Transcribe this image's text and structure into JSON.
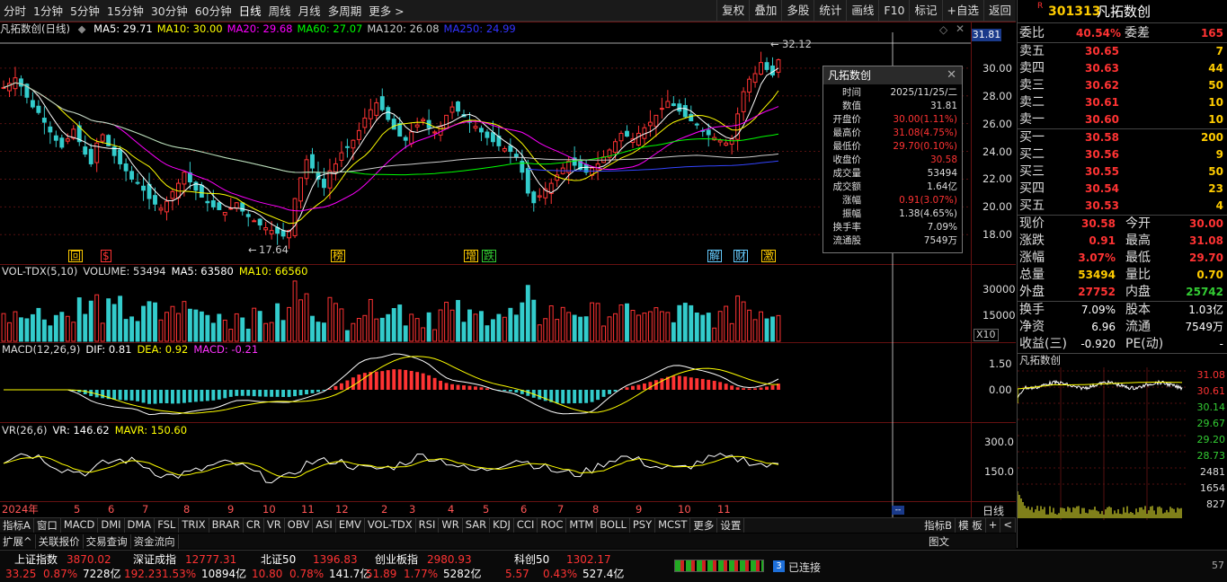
{
  "toolbar": {
    "periods": [
      "分时",
      "1分钟",
      "5分钟",
      "15分钟",
      "30分钟",
      "60分钟",
      "日线",
      "周线",
      "月线",
      "多周期",
      "更多 >"
    ],
    "active_period": "日线",
    "actions": [
      "复权",
      "叠加",
      "多股",
      "统计",
      "画线",
      "F10",
      "标记",
      "+自选",
      "返回"
    ]
  },
  "chart_header": {
    "name": "凡拓数创(日线)",
    "ma": [
      {
        "label": "MA5: 29.71",
        "color": "#ffffff"
      },
      {
        "label": "MA10: 30.00",
        "color": "#ffff00"
      },
      {
        "label": "MA20: 29.68",
        "color": "#ff00ff"
      },
      {
        "label": "MA60: 27.07",
        "color": "#00ff00"
      },
      {
        "label": "MA120: 26.08",
        "color": "#cccccc"
      },
      {
        "label": "MA250: 24.99",
        "color": "#3333ff"
      }
    ],
    "high_mark": "32.12",
    "low_mark": "17.64",
    "current_price_tag": "31.81",
    "price_axis": [
      "30.00",
      "28.00",
      "26.00",
      "24.00",
      "22.00",
      "20.00",
      "18.00"
    ],
    "event_markers": [
      {
        "text": "回",
        "color": "#ffcc00"
      },
      {
        "text": "$",
        "color": "#ff3333"
      },
      {
        "text": "榜",
        "color": "#ffcc00"
      },
      {
        "text": "增",
        "color": "#ffcc00"
      },
      {
        "text": "跌",
        "color": "#33cc33"
      },
      {
        "text": "解",
        "color": "#66ccff"
      },
      {
        "text": "财",
        "color": "#66ccff"
      },
      {
        "text": "激",
        "color": "#ffcc00"
      }
    ]
  },
  "popup": {
    "title": "凡拓数创",
    "rows": [
      {
        "k": "时间",
        "v": "2025/11/25/二",
        "c": "#dddddd"
      },
      {
        "k": "数值",
        "v": "31.81",
        "c": "#dddddd"
      },
      {
        "k": "开盘价",
        "v": "30.00(1.11%)",
        "c": "#ff3333"
      },
      {
        "k": "最高价",
        "v": "31.08(4.75%)",
        "c": "#ff3333"
      },
      {
        "k": "最低价",
        "v": "29.70(0.10%)",
        "c": "#ff3333"
      },
      {
        "k": "收盘价",
        "v": "30.58",
        "c": "#ff3333"
      },
      {
        "k": "成交量",
        "v": "53494",
        "c": "#dddddd"
      },
      {
        "k": "成交额",
        "v": "1.64亿",
        "c": "#dddddd"
      },
      {
        "k": "涨幅",
        "v": "0.91(3.07%)",
        "c": "#ff3333"
      },
      {
        "k": "振幅",
        "v": "1.38(4.65%)",
        "c": "#dddddd"
      },
      {
        "k": "换手率",
        "v": "7.09%",
        "c": "#dddddd"
      },
      {
        "k": "流通股",
        "v": "7549万",
        "c": "#dddddd"
      }
    ]
  },
  "vol_panel": {
    "header": [
      "VOL-TDX(5,10)",
      "VOLUME: 53494",
      "MA5: 63580",
      "MA10: 66560"
    ],
    "axis": [
      "30000",
      "15000"
    ],
    "unit": "X10"
  },
  "macd_panel": {
    "header": [
      "MACD(12,26,9)",
      "DIF: 0.81",
      "DEA: 0.92",
      "MACD: -0.21"
    ],
    "axis": [
      "1.50",
      "0.00"
    ]
  },
  "vr_panel": {
    "header": [
      "VR(26,6)",
      "VR: 146.62",
      "MAVR: 150.60"
    ],
    "axis": [
      "300.0",
      "150.0"
    ]
  },
  "time_axis": [
    "2024年",
    "5",
    "6",
    "7",
    "8",
    "9",
    "10",
    "11",
    "12",
    "2",
    "3",
    "4",
    "5",
    "6",
    "7",
    "8",
    "9",
    "10",
    "11"
  ],
  "bottom_period_label": "日线",
  "indicator_tabs": [
    "指标A",
    "窗口",
    "MACD",
    "DMI",
    "DMA",
    "FSL",
    "TRIX",
    "BRAR",
    "CR",
    "VR",
    "OBV",
    "ASI",
    "EMV",
    "VOL-TDX",
    "RSI",
    "WR",
    "SAR",
    "KDJ",
    "CCI",
    "ROC",
    "MTM",
    "BOLL",
    "PSY",
    "MCST",
    "更多",
    "设置"
  ],
  "indicator_tabs_right": [
    "指标B",
    "模 板",
    "+",
    "<"
  ],
  "sub_tabs": [
    "扩展^",
    "关联报价",
    "交易查询",
    "资金流向"
  ],
  "sub_tabs_right": "图文",
  "right_panel": {
    "code": "301313",
    "name": "凡拓数创",
    "badge": "R",
    "weibi": {
      "label": "委比",
      "value": "40.54%",
      "label2": "委差",
      "value2": "165"
    },
    "sells": [
      {
        "label": "卖五",
        "price": "30.65",
        "vol": "7"
      },
      {
        "label": "卖四",
        "price": "30.63",
        "vol": "44"
      },
      {
        "label": "卖三",
        "price": "30.62",
        "vol": "50"
      },
      {
        "label": "卖二",
        "price": "30.61",
        "vol": "10"
      },
      {
        "label": "卖一",
        "price": "30.60",
        "vol": "10"
      }
    ],
    "buys": [
      {
        "label": "买一",
        "price": "30.58",
        "vol": "200"
      },
      {
        "label": "买二",
        "price": "30.56",
        "vol": "9"
      },
      {
        "label": "买三",
        "price": "30.55",
        "vol": "50"
      },
      {
        "label": "买四",
        "price": "30.54",
        "vol": "23"
      },
      {
        "label": "买五",
        "price": "30.53",
        "vol": "4"
      }
    ],
    "quote": [
      {
        "l1": "现价",
        "v1": "30.58",
        "c1": "#ff3333",
        "l2": "今开",
        "v2": "30.00",
        "c2": "#ff3333"
      },
      {
        "l1": "涨跌",
        "v1": "0.91",
        "c1": "#ff3333",
        "l2": "最高",
        "v2": "31.08",
        "c2": "#ff3333"
      },
      {
        "l1": "涨幅",
        "v1": "3.07%",
        "c1": "#ff3333",
        "l2": "最低",
        "v2": "29.70",
        "c2": "#ff3333"
      },
      {
        "l1": "总量",
        "v1": "53494",
        "c1": "#ffcc00",
        "l2": "量比",
        "v2": "0.70",
        "c2": "#ffcc00"
      },
      {
        "l1": "外盘",
        "v1": "27752",
        "c1": "#ff3333",
        "l2": "内盘",
        "v2": "25742",
        "c2": "#33cc33"
      }
    ],
    "stats": [
      {
        "l1": "换手",
        "v1": "7.09%",
        "l2": "股本",
        "v2": "1.03亿"
      },
      {
        "l1": "净资",
        "v1": "6.96",
        "l2": "流通",
        "v2": "7549万"
      },
      {
        "l1": "收益(三)",
        "v1": "-0.920",
        "l2": "PE(动)",
        "v2": "-"
      }
    ],
    "mini_title": "凡拓数创",
    "mini_axis": [
      "31.08",
      "30.61",
      "30.14",
      "29.67",
      "29.20",
      "28.73",
      "2481",
      "1654",
      "827"
    ]
  },
  "status_bar": {
    "indices": [
      {
        "name": "上证指数",
        "value": "3870.02",
        "chg": "33.25",
        "pct": "0.87%",
        "amt": "7228亿"
      },
      {
        "name": "深证成指",
        "value": "12777.31",
        "chg": "192.23",
        "pct": "1.53%",
        "amt": "10894亿"
      },
      {
        "name": "北证50",
        "value": "1396.83",
        "chg": "10.80",
        "pct": "0.78%",
        "amt": "141.7亿"
      },
      {
        "name": "创业板指",
        "value": "2980.93",
        "chg": "51.89",
        "pct": "1.77%",
        "amt": "5282亿"
      },
      {
        "name": "科创50",
        "value": "1302.17",
        "chg": "5.57",
        "pct": "0.43%",
        "amt": "527.4亿"
      }
    ],
    "conn_badge": "3",
    "conn_text": "已连接",
    "corner": "57"
  },
  "chart_data": {
    "type": "candlestick",
    "close": [
      28.6,
      28.9,
      29.3,
      28.7,
      27.9,
      27.2,
      26.8,
      26.1,
      25.4,
      24.8,
      24.3,
      24.9,
      25.6,
      24.7,
      23.8,
      23.1,
      24.6,
      25.2,
      24.4,
      23.7,
      23.1,
      22.6,
      22.0,
      21.7,
      21.2,
      20.6,
      20.2,
      19.9,
      20.4,
      21.1,
      21.7,
      22.5,
      21.8,
      21.2,
      20.7,
      20.3,
      20.0,
      19.8,
      19.6,
      19.9,
      20.3,
      19.7,
      19.3,
      19.0,
      18.7,
      18.5,
      18.3,
      18.1,
      17.9,
      18.3,
      20.6,
      22.1,
      23.4,
      22.8,
      22.0,
      21.4,
      22.6,
      23.1,
      23.9,
      24.3,
      24.8,
      25.5,
      26.4,
      27.0,
      27.5,
      27.0,
      26.3,
      25.6,
      25.1,
      24.8,
      25.4,
      25.9,
      26.3,
      25.7,
      25.4,
      25.8,
      26.6,
      27.2,
      26.9,
      26.5,
      26.1,
      25.8,
      25.4,
      25.0,
      24.7,
      24.4,
      24.2,
      24.0,
      23.6,
      22.5,
      21.0,
      20.3,
      20.8,
      21.3,
      21.7,
      22.3,
      22.8,
      23.3,
      23.0,
      22.7,
      22.5,
      22.8,
      23.1,
      23.6,
      24.1,
      24.7,
      25.3,
      25.1,
      24.9,
      25.3,
      25.7,
      26.1,
      26.6,
      27.1,
      27.6,
      27.3,
      26.9,
      26.5,
      26.2,
      25.9,
      25.5,
      25.2,
      25.0,
      24.8,
      24.6,
      24.9,
      26.7,
      28.3,
      29.2,
      29.6,
      30.4,
      29.9,
      29.5,
      30.6
    ]
  }
}
